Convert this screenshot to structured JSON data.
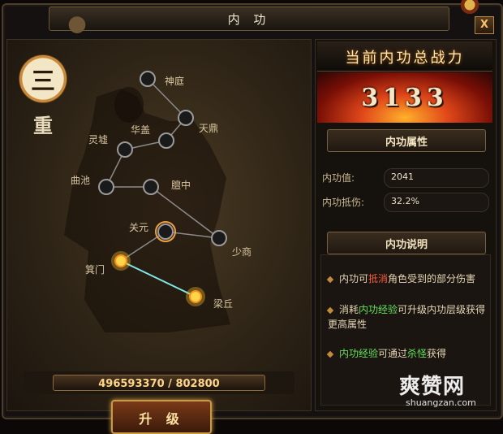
{
  "window": {
    "title": "内 功",
    "close_label": "X"
  },
  "rank": {
    "number": "三",
    "unit": "重"
  },
  "nodes": [
    {
      "label": "神庭",
      "state": "active"
    },
    {
      "label": "天鼎",
      "state": "active"
    },
    {
      "label": "华盖",
      "state": "active"
    },
    {
      "label": "灵墟",
      "state": "active"
    },
    {
      "label": "曲池",
      "state": "active"
    },
    {
      "label": "膻中",
      "state": "active"
    },
    {
      "label": "少商",
      "state": "active"
    },
    {
      "label": "关元",
      "state": "current"
    },
    {
      "label": "箕门",
      "state": "locked"
    },
    {
      "label": "梁丘",
      "state": "locked"
    }
  ],
  "experience": {
    "text": "496593370 / 802800"
  },
  "upgrade_label": "升 级",
  "power": {
    "label": "当前内功总战力",
    "value": "3133"
  },
  "attributes": {
    "heading": "内功属性",
    "rows": [
      {
        "label": "内功值:",
        "value": "2041"
      },
      {
        "label": "内功抵伤:",
        "value": "32.2%"
      }
    ]
  },
  "description": {
    "heading": "内功说明",
    "items": [
      {
        "pre": "内功可",
        "hl": "抵消",
        "post": "角色受到的部分伤害"
      },
      {
        "pre": "消耗",
        "hl": "内功经验",
        "post": "可升级内功层级获得更高属性"
      },
      {
        "pre": "",
        "hl": "内功经验",
        "post": "可通过",
        "hl2": "杀怪",
        "post2": "获得"
      }
    ]
  },
  "watermark": {
    "main": "爽赞网",
    "sub": "shuangzan.com"
  },
  "colors": {
    "accent": "#c99a45",
    "highlight_red": "#ff5a3a",
    "highlight_green": "#66e05a",
    "link_line": "#7fe8e6"
  }
}
